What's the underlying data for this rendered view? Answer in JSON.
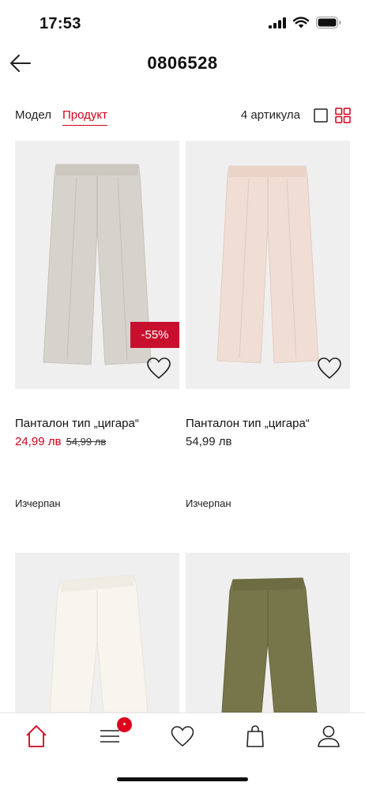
{
  "status_bar": {
    "time": "17:53"
  },
  "nav": {
    "title": "0806528"
  },
  "filters": {
    "tab_model": "Модел",
    "tab_product": "Продукт",
    "article_count": "4 артикула",
    "active_tab": "Продукт"
  },
  "products": [
    {
      "name": "Панталон тип „цигара“",
      "price": "24,99 лв",
      "old_price": "54,99 лв",
      "discount": "-55%",
      "status": "Изчерпан",
      "color": "#d6d3cc"
    },
    {
      "name": "Панталон тип „цигара“",
      "price": "54,99 лв",
      "status": "Изчерпан",
      "color": "#f0ddd3"
    },
    {
      "color": "#f7f5ee"
    },
    {
      "color": "#77764a"
    }
  ],
  "tab_bar": {
    "items": [
      "home-icon",
      "menu-icon",
      "heart-icon",
      "bag-icon",
      "user-icon"
    ],
    "menu_badge": "•"
  },
  "colors": {
    "accent": "#d0021b",
    "badge": "#c8102e"
  }
}
